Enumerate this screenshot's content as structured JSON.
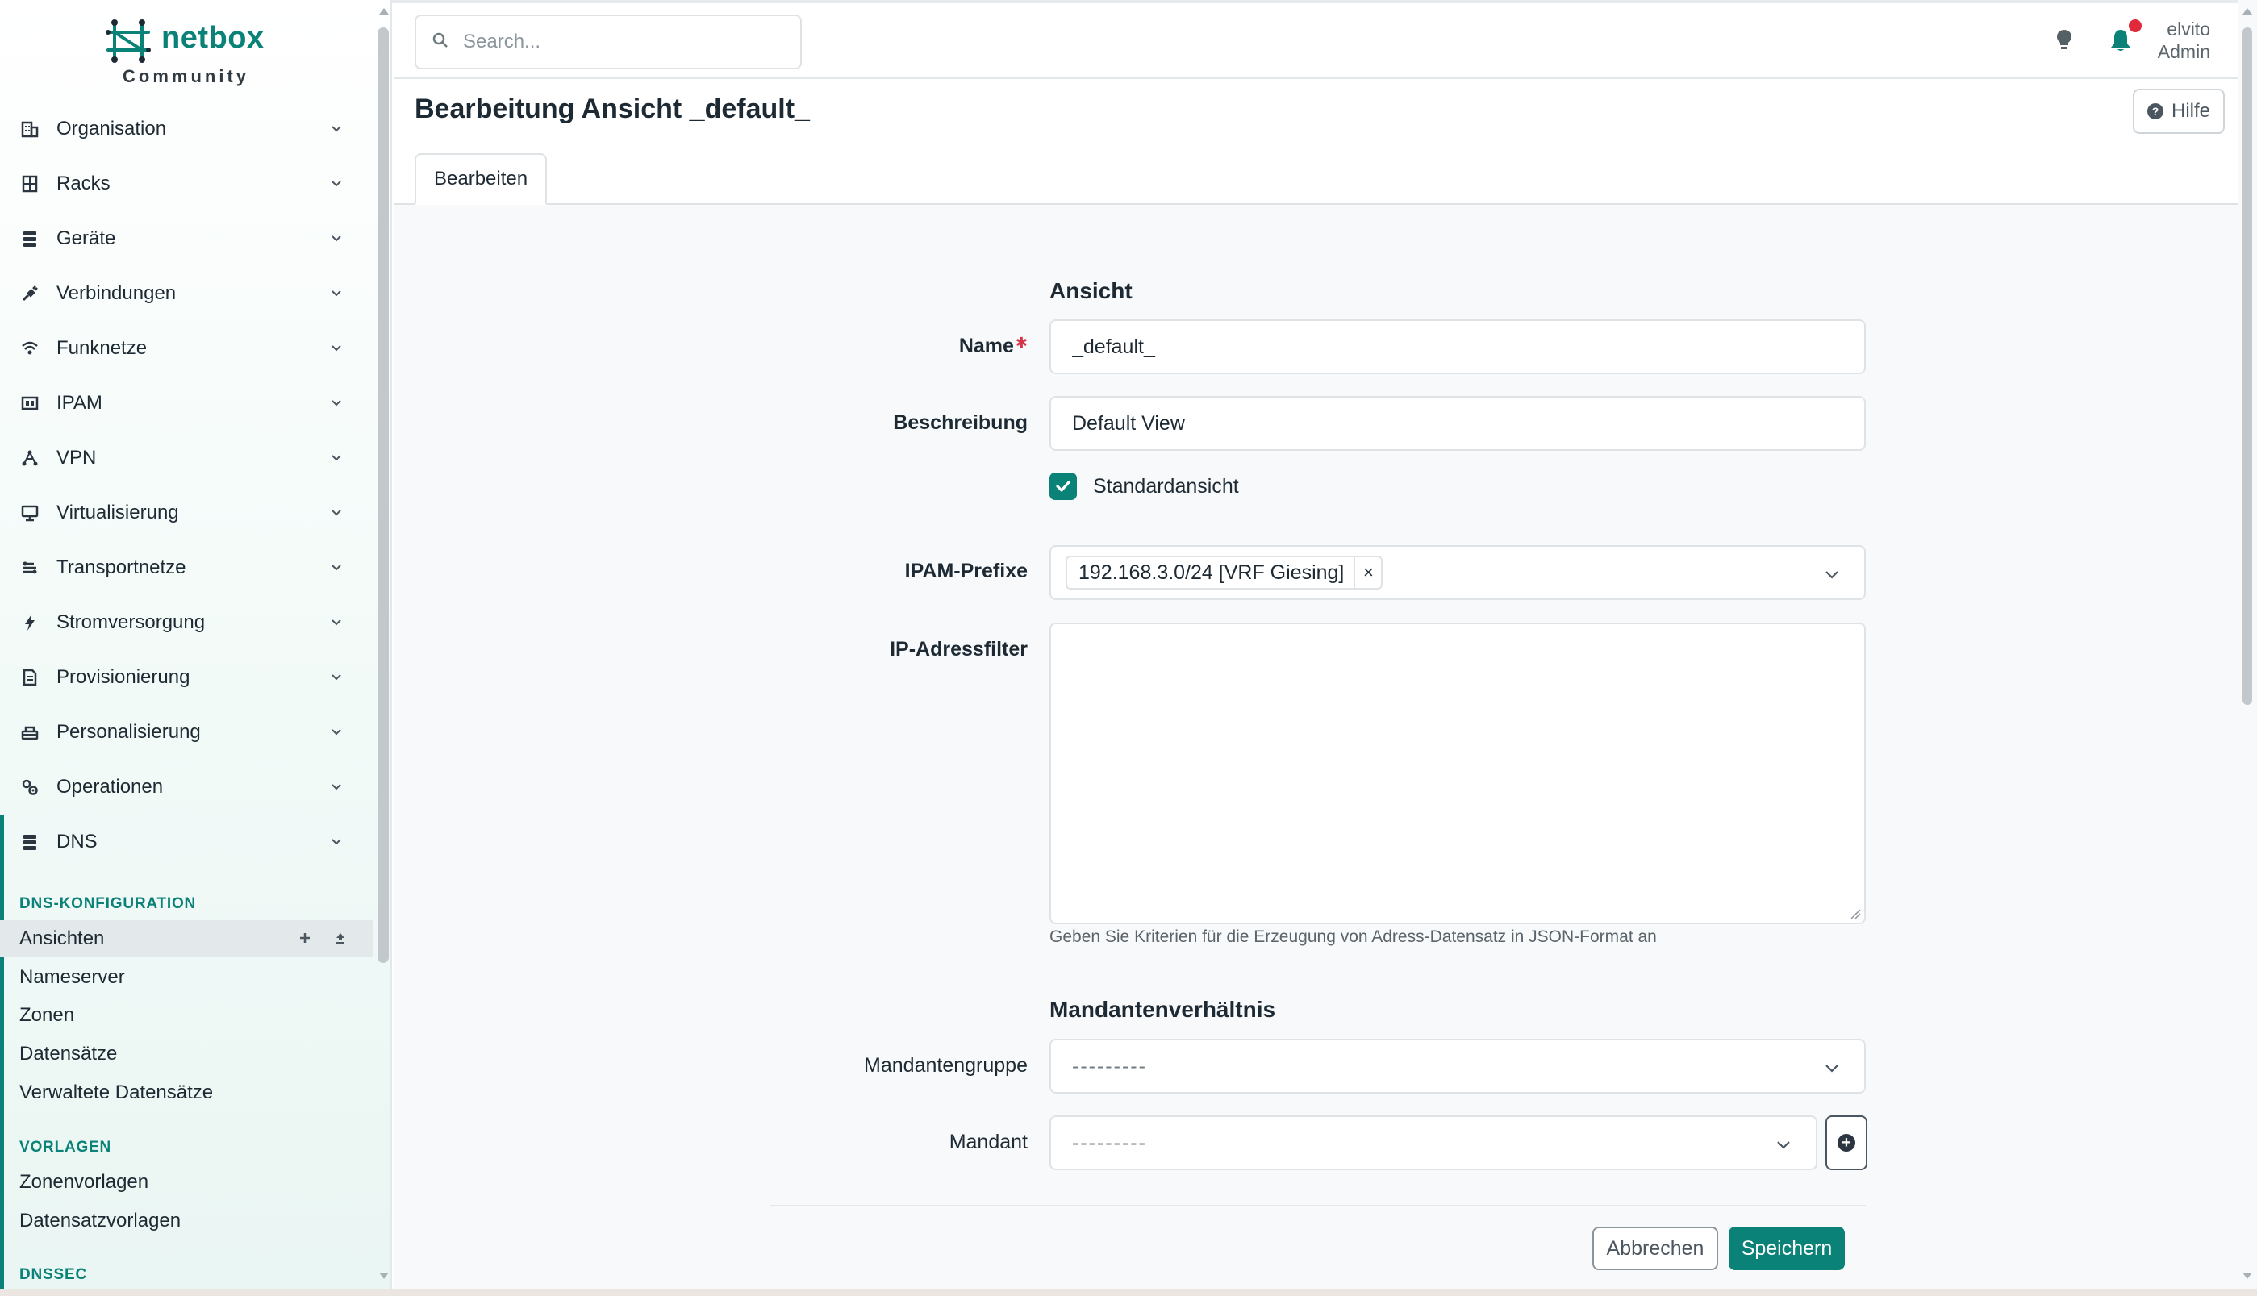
{
  "brand": {
    "name": "netbox",
    "edition": "Community",
    "accent": "#0a8277"
  },
  "search": {
    "placeholder": "Search..."
  },
  "user": {
    "name": "elvito",
    "role": "Admin"
  },
  "sidebar": {
    "menu": [
      {
        "label": "Organisation",
        "icon": "building-icon"
      },
      {
        "label": "Racks",
        "icon": "rack-icon"
      },
      {
        "label": "Geräte",
        "icon": "server-icon"
      },
      {
        "label": "Verbindungen",
        "icon": "cable-icon"
      },
      {
        "label": "Funknetze",
        "icon": "wifi-icon"
      },
      {
        "label": "IPAM",
        "icon": "ip-icon"
      },
      {
        "label": "VPN",
        "icon": "tunnel-icon"
      },
      {
        "label": "Virtualisierung",
        "icon": "monitor-icon"
      },
      {
        "label": "Transportnetze",
        "icon": "transport-icon"
      },
      {
        "label": "Stromversorgung",
        "icon": "power-icon"
      },
      {
        "label": "Provisionierung",
        "icon": "document-icon"
      },
      {
        "label": "Personalisierung",
        "icon": "customize-icon"
      },
      {
        "label": "Operationen",
        "icon": "cogs-icon"
      }
    ],
    "dns": {
      "label": "DNS",
      "groups": [
        {
          "heading": "DNS-KONFIGURATION",
          "items": [
            "Ansichten",
            "Nameserver",
            "Zonen",
            "Datensätze",
            "Verwaltete Datensätze"
          ]
        },
        {
          "heading": "VORLAGEN",
          "items": [
            "Zonenvorlagen",
            "Datensatzvorlagen"
          ]
        },
        {
          "heading": "DNSSEC",
          "items": []
        }
      ],
      "active_item": "Ansichten"
    }
  },
  "page": {
    "title": "Bearbeitung Ansicht _default_",
    "help_label": "Hilfe",
    "tab": "Bearbeiten"
  },
  "form": {
    "section_view": "Ansicht",
    "name_label": "Name",
    "name_value": "_default_",
    "description_label": "Beschreibung",
    "description_value": "Default View",
    "default_view_label": "Standardansicht",
    "default_view_checked": true,
    "prefixes_label": "IPAM-Prefixe",
    "prefixes": [
      "192.168.3.0/24 [VRF Giesing]"
    ],
    "ip_filter_label": "IP-Adressfilter",
    "ip_filter_value": "",
    "ip_filter_help": "Geben Sie Kriterien für die Erzeugung von Adress-Datensatz in JSON-Format an",
    "section_tenancy": "Mandantenverhältnis",
    "tenant_group_label": "Mandantengruppe",
    "tenant_group_value": "---------",
    "tenant_label": "Mandant",
    "tenant_value": "---------",
    "cancel_label": "Abbrechen",
    "save_label": "Speichern"
  }
}
